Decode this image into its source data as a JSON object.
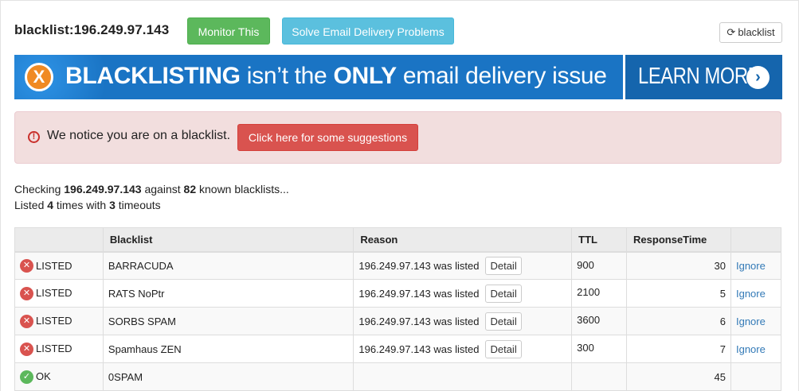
{
  "header": {
    "title": "blacklist:196.249.97.143",
    "monitor_label": "Monitor This",
    "solve_label": "Solve Email Delivery Problems",
    "refresh_label": "blacklist"
  },
  "banner": {
    "x_glyph": "X",
    "text_bold1": "BLACKLISTING",
    "text_mid": " isn’t the ",
    "text_bold2": "ONLY",
    "text_end": " email delivery issue",
    "learn_more": "LEARN MORE",
    "colors": {
      "background": "#1a74c4",
      "accent": "#f08a24"
    }
  },
  "alert": {
    "text": "We notice you are on a blacklist.",
    "button_label": "Click here for some suggestions"
  },
  "summary": {
    "checking_prefix": "Checking ",
    "ip": "196.249.97.143",
    "against": " against ",
    "count": "82",
    "known": " known blacklists...",
    "listed_prefix": "Listed ",
    "listed_count": "4",
    "times_with": " times with ",
    "timeouts": "3",
    "timeouts_suffix": " timeouts"
  },
  "table": {
    "headers": [
      "",
      "Blacklist",
      "Reason",
      "TTL",
      "ResponseTime",
      ""
    ],
    "rows": [
      {
        "status": "LISTED",
        "blacklist": "BARRACUDA",
        "reason": "196.249.97.143 was listed",
        "detail": "Detail",
        "ttl": "900",
        "response": "30",
        "action": "Ignore"
      },
      {
        "status": "LISTED",
        "blacklist": "RATS NoPtr",
        "reason": "196.249.97.143 was listed",
        "detail": "Detail",
        "ttl": "2100",
        "response": "5",
        "action": "Ignore"
      },
      {
        "status": "LISTED",
        "blacklist": "SORBS SPAM",
        "reason": "196.249.97.143 was listed",
        "detail": "Detail",
        "ttl": "3600",
        "response": "6",
        "action": "Ignore"
      },
      {
        "status": "LISTED",
        "blacklist": "Spamhaus ZEN",
        "reason": "196.249.97.143 was listed",
        "detail": "Detail",
        "ttl": "300",
        "response": "7",
        "action": "Ignore"
      },
      {
        "status": "OK",
        "blacklist": "0SPAM",
        "reason": "",
        "detail": "",
        "ttl": "",
        "response": "45",
        "action": ""
      }
    ]
  }
}
